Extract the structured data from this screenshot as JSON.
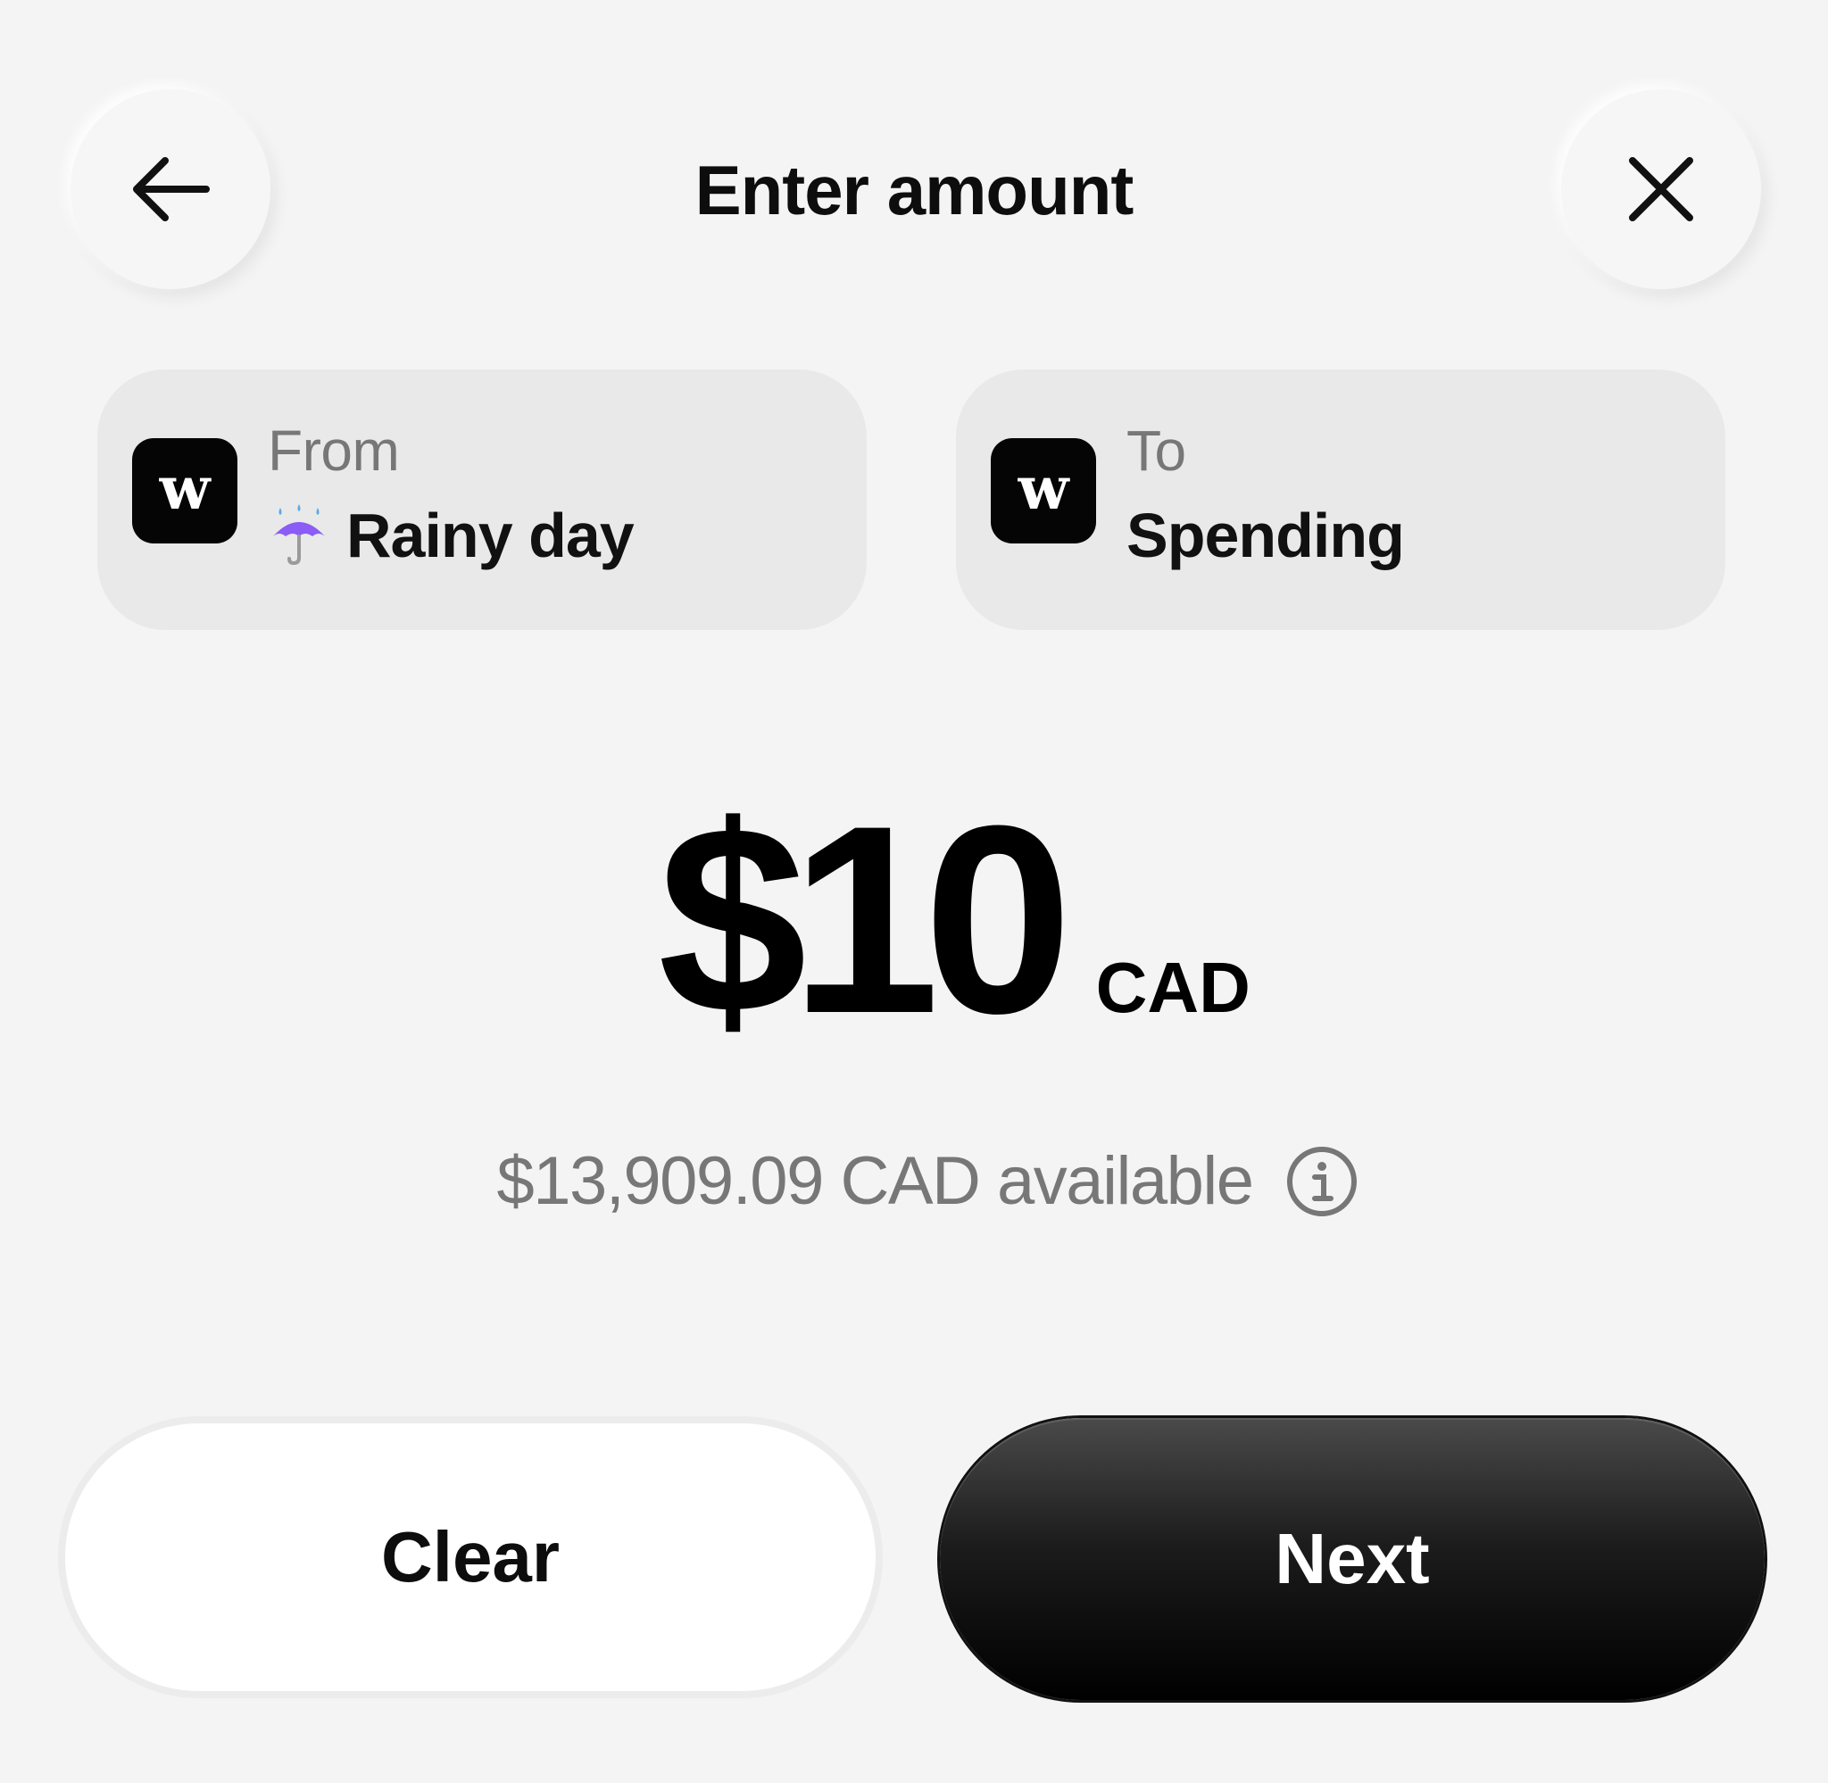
{
  "header": {
    "title": "Enter amount",
    "back_icon": "arrow-left-icon",
    "close_icon": "close-icon"
  },
  "from_account": {
    "label": "From",
    "emoji": "☔",
    "emoji_icon": "umbrella-with-rain-icon",
    "name": "Rainy day",
    "logo_letter": "w"
  },
  "to_account": {
    "label": "To",
    "name": "Spending",
    "logo_letter": "w"
  },
  "amount": {
    "value": "$10",
    "currency": "CAD"
  },
  "available": {
    "text": "$13,909.09 CAD available",
    "info_icon": "info-icon"
  },
  "actions": {
    "clear_label": "Clear",
    "next_label": "Next"
  },
  "colors": {
    "background": "#f4f4f4",
    "card_background": "#e9e9e9",
    "primary_button": "#000000",
    "secondary_text": "#777777"
  }
}
